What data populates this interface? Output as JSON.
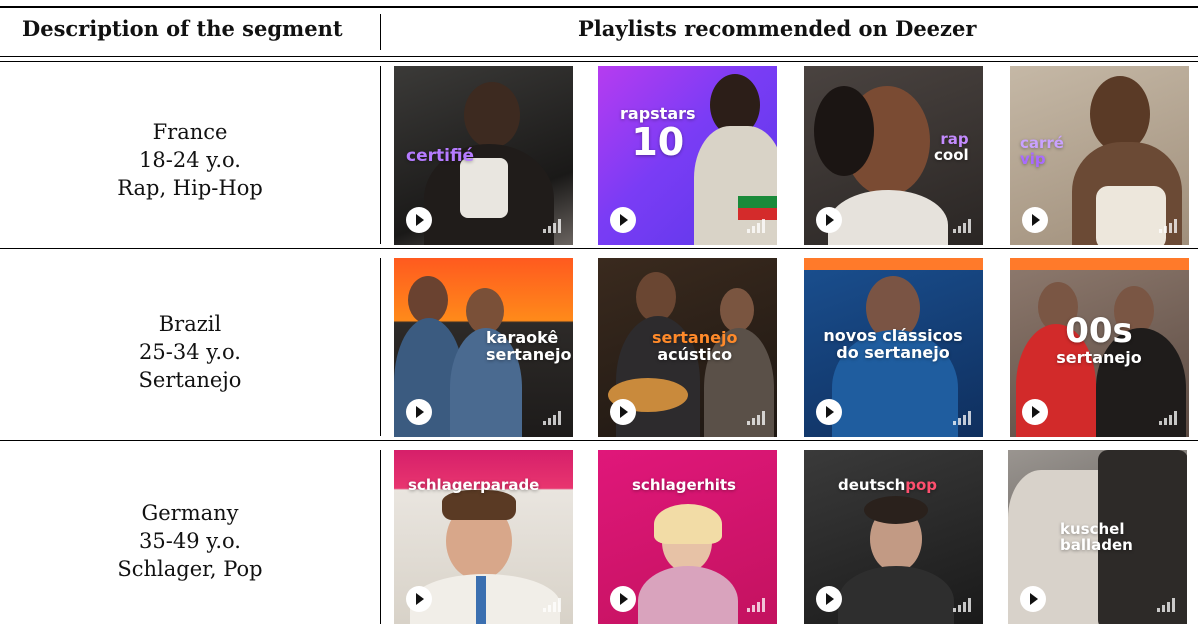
{
  "header": {
    "col1": "Description of the segment",
    "col2": "Playlists recommended on Deezer"
  },
  "rows": [
    {
      "segment": [
        "France",
        "18-24 y.o.",
        "Rap, Hip-Hop"
      ],
      "tiles": [
        {
          "lines": [
            {
              "text": "certifié",
              "color": "#b57bff"
            }
          ]
        },
        {
          "lines": [
            {
              "text": "rapstars",
              "color": "#ffffff"
            },
            {
              "text": "10",
              "color": "#ffffff"
            }
          ]
        },
        {
          "lines": [
            {
              "text": "rap",
              "color": "#c48bff"
            },
            {
              "text": "cool",
              "color": "#ffffff"
            }
          ]
        },
        {
          "lines": [
            {
              "text": "carré",
              "color": "#c9a2ff"
            },
            {
              "text": "vip",
              "color": "#a96bff"
            }
          ]
        }
      ]
    },
    {
      "segment": [
        "Brazil",
        "25-34 y.o.",
        "Sertanejo"
      ],
      "tiles": [
        {
          "lines": [
            {
              "text": "karaokê",
              "color": "#ffffff"
            },
            {
              "text": "sertanejo",
              "color": "#ffffff"
            }
          ]
        },
        {
          "lines": [
            {
              "text": "sertanejo",
              "color": "#ff8a2a"
            },
            {
              "text": "acústico",
              "color": "#ffffff"
            }
          ]
        },
        {
          "lines": [
            {
              "text": "novos clássicos",
              "color": "#ffffff"
            },
            {
              "text": "do sertanejo",
              "color": "#ffffff"
            }
          ]
        },
        {
          "lines": [
            {
              "text": "00s",
              "color": "#ffffff"
            },
            {
              "text": "sertanejo",
              "color": "#ffffff"
            }
          ]
        }
      ]
    },
    {
      "segment": [
        "Germany",
        "35-49 y.o.",
        "Schlager, Pop"
      ],
      "tiles": [
        {
          "lines": [
            {
              "text": "schlagerparade",
              "color": "#ffffff"
            }
          ]
        },
        {
          "lines": [
            {
              "text": "schlagerhits",
              "color": "#ffffff"
            }
          ]
        },
        {
          "lines": [
            {
              "text": "deutsch",
              "color": "#ffffff"
            },
            {
              "text": "pop",
              "color": "#ff4f6e"
            }
          ]
        },
        {
          "lines": [
            {
              "text": "kuschel",
              "color": "#ffffff"
            },
            {
              "text": "balladen",
              "color": "#ffffff"
            }
          ]
        }
      ]
    }
  ]
}
